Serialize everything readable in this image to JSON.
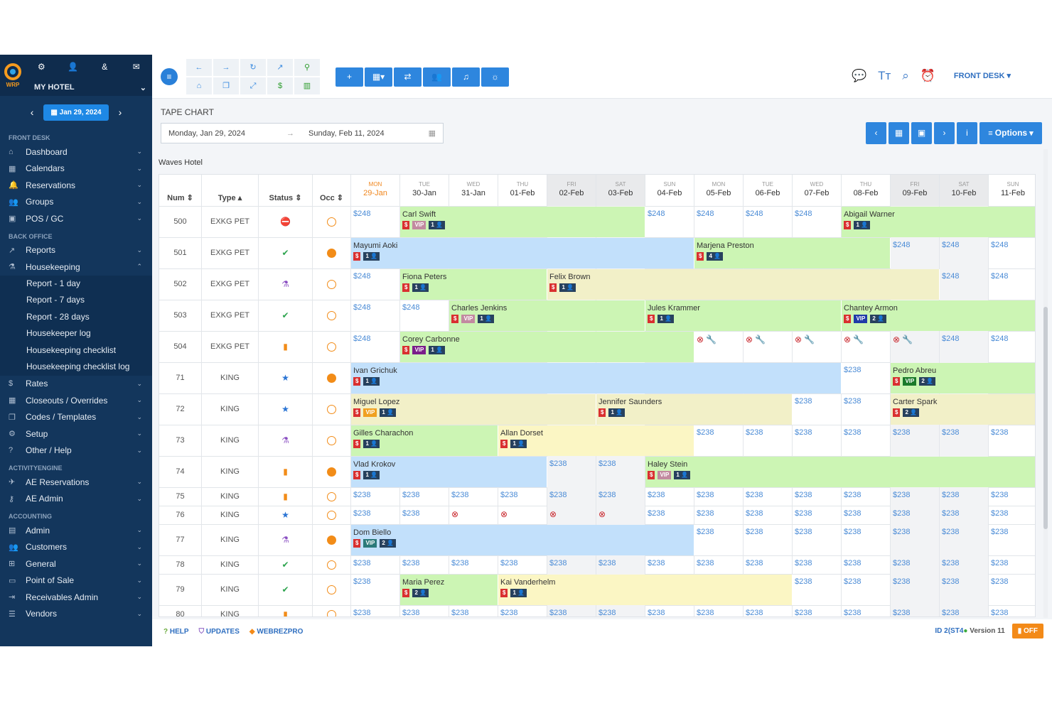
{
  "sidebar": {
    "logo": "WRP",
    "hotel": "MY HOTEL",
    "date": "Jan 29, 2024",
    "sections": [
      {
        "title": "FRONT DESK",
        "items": [
          {
            "label": "Dashboard",
            "icon": "home-icon"
          },
          {
            "label": "Calendars",
            "icon": "calendar-icon"
          },
          {
            "label": "Reservations",
            "icon": "bell-icon"
          },
          {
            "label": "Groups",
            "icon": "users-icon"
          },
          {
            "label": "POS / GC",
            "icon": "bag-icon"
          }
        ]
      },
      {
        "title": "BACK OFFICE",
        "items": [
          {
            "label": "Reports",
            "icon": "chart-icon"
          },
          {
            "label": "Housekeeping",
            "icon": "broom-icon",
            "expanded": true,
            "subitems": [
              "Report - 1 day",
              "Report - 7 days",
              "Report - 28 days",
              "Housekeeper log",
              "Housekeeping checklist",
              "Housekeeping checklist log"
            ]
          },
          {
            "label": "Rates",
            "icon": "dollar-icon"
          },
          {
            "label": "Closeouts / Overrides",
            "icon": "calendar-x-icon"
          },
          {
            "label": "Codes / Templates",
            "icon": "copy-icon"
          },
          {
            "label": "Setup",
            "icon": "gear-icon"
          },
          {
            "label": "Other / Help",
            "icon": "question-icon"
          }
        ]
      },
      {
        "title": "ACTIVITYENGINE",
        "items": [
          {
            "label": "AE Reservations",
            "icon": "rocket-icon"
          },
          {
            "label": "AE Admin",
            "icon": "key-icon"
          }
        ]
      },
      {
        "title": "ACCOUNTING",
        "items": [
          {
            "label": "Admin",
            "icon": "ledger-icon"
          },
          {
            "label": "Customers",
            "icon": "customers-icon"
          },
          {
            "label": "General",
            "icon": "table-icon"
          },
          {
            "label": "Point of Sale",
            "icon": "window-icon"
          },
          {
            "label": "Receivables Admin",
            "icon": "login-icon"
          },
          {
            "label": "Vendors",
            "icon": "list-icon"
          }
        ]
      }
    ]
  },
  "toolbar": {
    "front_desk": "FRONT DESK"
  },
  "main": {
    "title": "TAPE CHART",
    "start_date": "Monday, Jan 29, 2024",
    "end_date": "Sunday, Feb 11, 2024",
    "options_label": "Options",
    "hotel_name": "Waves Hotel"
  },
  "table": {
    "col_labels": [
      "Num",
      "Type",
      "Status",
      "Occ"
    ],
    "days": [
      {
        "dw": "MON",
        "dd": "29-Jan",
        "today": true
      },
      {
        "dw": "TUE",
        "dd": "30-Jan"
      },
      {
        "dw": "WED",
        "dd": "31-Jan"
      },
      {
        "dw": "THU",
        "dd": "01-Feb"
      },
      {
        "dw": "FRI",
        "dd": "02-Feb",
        "we": true
      },
      {
        "dw": "SAT",
        "dd": "03-Feb",
        "we": true
      },
      {
        "dw": "SUN",
        "dd": "04-Feb"
      },
      {
        "dw": "MON",
        "dd": "05-Feb"
      },
      {
        "dw": "TUE",
        "dd": "06-Feb"
      },
      {
        "dw": "WED",
        "dd": "07-Feb"
      },
      {
        "dw": "THU",
        "dd": "08-Feb"
      },
      {
        "dw": "FRI",
        "dd": "09-Feb",
        "we": true
      },
      {
        "dw": "SAT",
        "dd": "10-Feb",
        "we": true
      },
      {
        "dw": "SUN",
        "dd": "11-Feb"
      }
    ],
    "rows": [
      {
        "num": "500",
        "type": "EXKG PET",
        "status": "blocked",
        "occ": "empty",
        "cells": [
          "$248",
          null,
          null,
          null,
          null,
          null,
          "$248",
          "$248",
          "$248",
          "$248",
          null,
          null,
          null,
          null
        ],
        "bookings": [
          {
            "name": "Carl Swift",
            "start": 1,
            "len": 5,
            "color": "g",
            "badges": [
              "$",
              "VIP",
              "1"
            ]
          },
          {
            "name": "Abigail Warner",
            "start": 10,
            "len": 4,
            "color": "g",
            "badges": [
              "$",
              "1"
            ]
          }
        ]
      },
      {
        "num": "501",
        "type": "EXKG PET",
        "status": "clean",
        "occ": "occupied",
        "cells": [
          null,
          null,
          null,
          null,
          null,
          null,
          null,
          null,
          null,
          null,
          null,
          "$248",
          "$248",
          "$248"
        ],
        "bookings": [
          {
            "name": "Mayumi Aoki",
            "start": 0,
            "len": 7,
            "color": "b",
            "badges": [
              "$",
              "1"
            ]
          },
          {
            "name": "Marjena Preston",
            "start": 7,
            "len": 4,
            "color": "g",
            "badges": [
              "$",
              "4"
            ]
          }
        ]
      },
      {
        "num": "502",
        "type": "EXKG PET",
        "status": "housekeeping",
        "occ": "empty",
        "cells": [
          "$248",
          null,
          null,
          null,
          null,
          null,
          null,
          null,
          null,
          null,
          null,
          null,
          "$248",
          "$248"
        ],
        "bookings": [
          {
            "name": "Fiona Peters",
            "start": 1,
            "len": 3,
            "color": "g",
            "badges": [
              "$",
              "1"
            ]
          },
          {
            "name": "Felix Brown",
            "start": 4,
            "len": 8,
            "color": "t",
            "badges": [
              "$",
              "1"
            ]
          }
        ]
      },
      {
        "num": "503",
        "type": "EXKG PET",
        "status": "clean",
        "occ": "empty",
        "cells": [
          "$248",
          "$248",
          null,
          null,
          null,
          null,
          null,
          null,
          null,
          null,
          null,
          null,
          null,
          null
        ],
        "bookings": [
          {
            "name": "Charles Jenkins",
            "start": 2,
            "len": 4,
            "color": "g",
            "badges": [
              "$",
              "VIP",
              "1"
            ]
          },
          {
            "name": "Jules Krammer",
            "start": 6,
            "len": 4,
            "color": "g",
            "badges": [
              "$",
              "1"
            ]
          },
          {
            "name": "Chantey Armon",
            "start": 10,
            "len": 4,
            "color": "g",
            "badges": [
              "$",
              "VIP",
              "2"
            ]
          }
        ]
      },
      {
        "num": "504",
        "type": "EXKG PET",
        "status": "dirty",
        "occ": "empty",
        "cells": [
          "$248",
          null,
          null,
          null,
          null,
          null,
          null,
          "maint",
          "maint",
          "maint",
          "maint",
          "maint",
          "$248",
          "$248"
        ],
        "bookings": [
          {
            "name": "Corey Carbonne",
            "start": 1,
            "len": 6,
            "color": "g",
            "badges": [
              "$",
              "VIP",
              "1"
            ]
          }
        ]
      },
      {
        "num": "71",
        "type": "KING",
        "status": "inspected",
        "occ": "occupied",
        "cells": [
          null,
          null,
          null,
          null,
          null,
          null,
          null,
          null,
          null,
          null,
          "$238",
          null,
          null,
          null
        ],
        "bookings": [
          {
            "name": "Ivan Grichuk",
            "start": 0,
            "len": 10,
            "color": "b",
            "badges": [
              "$",
              "1"
            ]
          },
          {
            "name": "Pedro Abreu",
            "start": 11,
            "len": 3,
            "color": "g",
            "badges": [
              "$",
              "VIP",
              "2"
            ]
          }
        ]
      },
      {
        "num": "72",
        "type": "KING",
        "status": "inspected",
        "occ": "empty",
        "cells": [
          null,
          null,
          null,
          null,
          null,
          null,
          null,
          null,
          null,
          "$238",
          "$238",
          null,
          null,
          null
        ],
        "bookings": [
          {
            "name": "Miguel Lopez",
            "start": 0,
            "len": 5,
            "color": "t",
            "badges": [
              "$",
              "VIP",
              "1"
            ]
          },
          {
            "name": "Jennifer Saunders",
            "start": 5,
            "len": 4,
            "color": "t",
            "badges": [
              "$",
              "1"
            ]
          },
          {
            "name": "Carter Spark",
            "start": 11,
            "len": 3,
            "color": "t",
            "badges": [
              "$",
              "2"
            ]
          }
        ]
      },
      {
        "num": "73",
        "type": "KING",
        "status": "housekeeping",
        "occ": "empty",
        "cells": [
          null,
          null,
          null,
          null,
          null,
          null,
          null,
          "$238",
          "$238",
          "$238",
          "$238",
          "$238",
          "$238",
          "$238"
        ],
        "bookings": [
          {
            "name": "Gilles Charachon",
            "start": 0,
            "len": 3,
            "color": "g",
            "badges": [
              "$",
              "1"
            ]
          },
          {
            "name": "Allan Dorset",
            "start": 3,
            "len": 4,
            "color": "y",
            "badges": [
              "$",
              "1"
            ]
          }
        ]
      },
      {
        "num": "74",
        "type": "KING",
        "status": "dirty",
        "occ": "occupied",
        "cells": [
          null,
          null,
          null,
          null,
          "$238",
          "$238",
          null,
          null,
          null,
          null,
          null,
          null,
          null,
          null
        ],
        "bookings": [
          {
            "name": "Vlad Krokov",
            "start": 0,
            "len": 4,
            "color": "b",
            "badges": [
              "$",
              "1"
            ]
          },
          {
            "name": "Haley Stein",
            "start": 6,
            "len": 8,
            "color": "g",
            "badges": [
              "$",
              "VIP",
              "1"
            ]
          }
        ]
      },
      {
        "num": "75",
        "type": "KING",
        "status": "dirty",
        "occ": "empty",
        "cells": [
          "$238",
          "$238",
          "$238",
          "$238",
          "$238",
          "$238",
          "$238",
          "$238",
          "$238",
          "$238",
          "$238",
          "$238",
          "$238",
          "$238"
        ],
        "bookings": []
      },
      {
        "num": "76",
        "type": "KING",
        "status": "inspected",
        "occ": "empty",
        "cells": [
          "$238",
          "$238",
          "closed",
          "closed",
          "closed",
          "closed",
          "$238",
          "$238",
          "$238",
          "$238",
          "$238",
          "$238",
          "$238",
          "$238"
        ],
        "bookings": []
      },
      {
        "num": "77",
        "type": "KING",
        "status": "housekeeping",
        "occ": "occupied",
        "cells": [
          null,
          null,
          null,
          null,
          null,
          null,
          null,
          "$238",
          "$238",
          "$238",
          "$238",
          "$238",
          "$238",
          "$238"
        ],
        "bookings": [
          {
            "name": "Dom Biello",
            "start": 0,
            "len": 7,
            "color": "b",
            "badges": [
              "$",
              "VIP",
              "2"
            ]
          }
        ]
      },
      {
        "num": "78",
        "type": "KING",
        "status": "clean",
        "occ": "empty",
        "cells": [
          "$238",
          "$238",
          "$238",
          "$238",
          "$238",
          "$238",
          "$238",
          "$238",
          "$238",
          "$238",
          "$238",
          "$238",
          "$238",
          "$238"
        ],
        "bookings": []
      },
      {
        "num": "79",
        "type": "KING",
        "status": "clean",
        "occ": "empty",
        "cells": [
          "$238",
          null,
          null,
          null,
          null,
          null,
          null,
          null,
          null,
          "$238",
          "$238",
          "$238",
          "$238",
          "$238"
        ],
        "bookings": [
          {
            "name": "Maria Perez",
            "start": 1,
            "len": 2,
            "color": "g",
            "badges": [
              "$",
              "2"
            ]
          },
          {
            "name": "Kai Vanderhelm",
            "start": 3,
            "len": 6,
            "color": "y",
            "badges": [
              "$",
              "1"
            ]
          }
        ]
      },
      {
        "num": "80",
        "type": "KING",
        "status": "dirty",
        "occ": "empty",
        "cells": [
          "$238",
          "$238",
          "$238",
          "$238",
          "$238",
          "$238",
          "$238",
          "$238",
          "$238",
          "$238",
          "$238",
          "$238",
          "$238",
          "$238"
        ],
        "bookings": []
      }
    ]
  },
  "footer": {
    "help": "HELP",
    "updates": "UPDATES",
    "webrezpro": "WEBREZPRO",
    "id": "ID 2(ST4",
    "version": "Version 11",
    "off": "OFF"
  }
}
